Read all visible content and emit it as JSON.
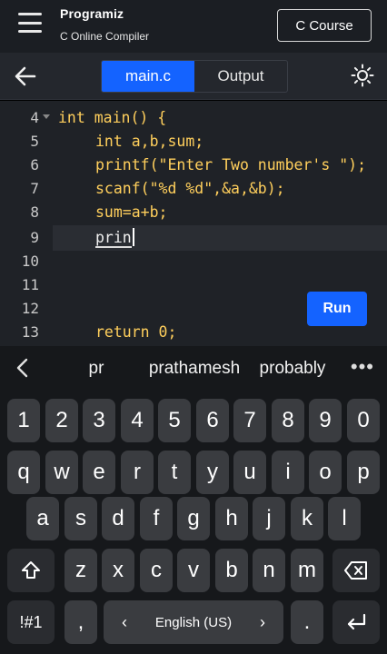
{
  "header": {
    "brand_name": "Programiz",
    "subtitle": "C Online Compiler",
    "course_button": "C Course"
  },
  "toolbar": {
    "tabs": [
      {
        "label": "main.c",
        "active": true
      },
      {
        "label": "Output",
        "active": false
      }
    ]
  },
  "editor": {
    "lines": [
      {
        "num": "4",
        "text": "int main() {"
      },
      {
        "num": "5",
        "text": "int a,b,sum;"
      },
      {
        "num": "6",
        "text": "printf(\"Enter Two number's \");"
      },
      {
        "num": "7",
        "text": "scanf(\"%d %d\",&a,&b);"
      },
      {
        "num": "8",
        "text": "sum=a+b;"
      },
      {
        "num": "9",
        "text": "prin"
      },
      {
        "num": "10",
        "text": ""
      },
      {
        "num": "11",
        "text": ""
      },
      {
        "num": "12",
        "text": ""
      },
      {
        "num": "13",
        "text": "return 0;"
      }
    ],
    "run_button": "Run"
  },
  "keyboard": {
    "suggestions": [
      "pr",
      "prathamesh",
      "probably"
    ],
    "more": "•••",
    "row_numbers": [
      "1",
      "2",
      "3",
      "4",
      "5",
      "6",
      "7",
      "8",
      "9",
      "0"
    ],
    "row1": [
      "q",
      "w",
      "e",
      "r",
      "t",
      "y",
      "u",
      "i",
      "o",
      "p"
    ],
    "row2": [
      "a",
      "s",
      "d",
      "f",
      "g",
      "h",
      "j",
      "k",
      "l"
    ],
    "row3": [
      "z",
      "x",
      "c",
      "v",
      "b",
      "n",
      "m"
    ],
    "symbols_key": "!#1",
    "comma_key": ",",
    "period_key": ".",
    "space_label": "English (US)",
    "colors": {
      "key": "#3a3c40",
      "key_dark": "#2a2c30",
      "accent": "#1463ff"
    }
  }
}
